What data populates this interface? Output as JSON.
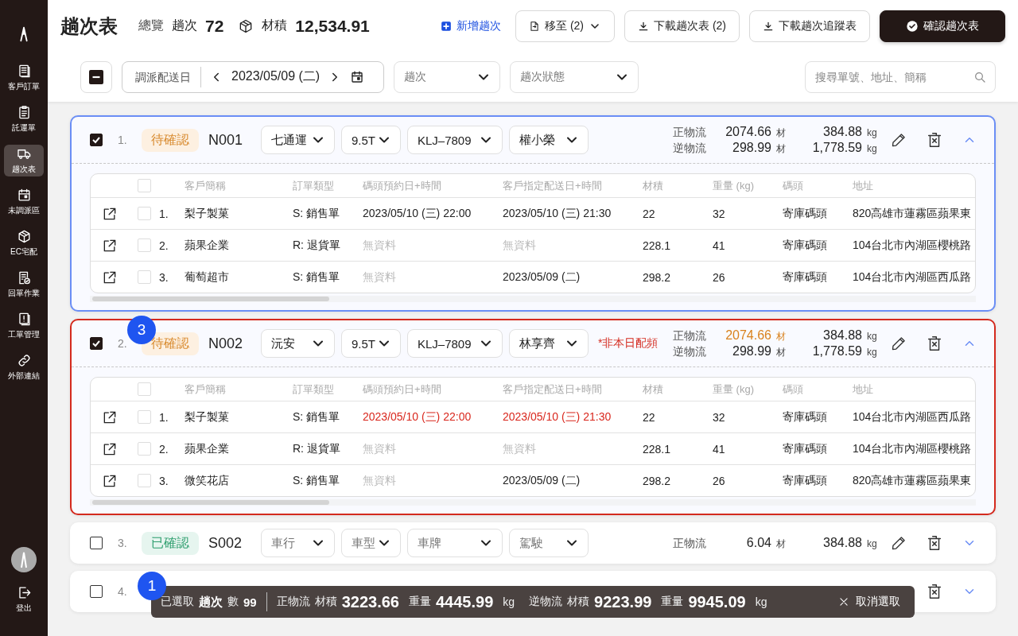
{
  "sidebar": {
    "items": [
      {
        "label": "客戶訂單",
        "kind": "orders",
        "selected": false
      },
      {
        "label": "託運單",
        "kind": "waybill",
        "selected": false
      },
      {
        "label": "趟次表",
        "kind": "trips",
        "selected": true
      },
      {
        "label": "未調派區",
        "kind": "unassigned",
        "selected": false
      },
      {
        "label": "EC宅配",
        "kind": "ec",
        "selected": false
      },
      {
        "label": "回單作業",
        "kind": "receipts",
        "selected": false
      },
      {
        "label": "工單管理",
        "kind": "workorders",
        "selected": false
      },
      {
        "label": "外部連結",
        "kind": "links",
        "selected": false
      }
    ],
    "logout": "登出"
  },
  "header": {
    "title": "趟次表",
    "overview_label": "總覽",
    "trip_label": "趟次",
    "trip_count": "72",
    "volume_label": "材積",
    "volume": "12,534.91",
    "actions": [
      {
        "label": "新增趟次",
        "kind": "link"
      },
      {
        "label": "移至 (2)",
        "kind": "menu"
      },
      {
        "label": "下載趟次表 (2)",
        "kind": "download"
      },
      {
        "label": "下載趟次追蹤表",
        "kind": "download"
      },
      {
        "label": "確認趟次表",
        "kind": "primary"
      }
    ]
  },
  "filters": {
    "date_label": "調派配送日",
    "date": "2023/05/09 (二)",
    "selects": [
      {
        "placeholder": "趟次"
      },
      {
        "placeholder": "趟次狀態"
      }
    ],
    "search": {
      "placeholder": "搜尋單號、地址、簡稱"
    }
  },
  "trips": [
    {
      "checked": true,
      "index": "1.",
      "status": {
        "label": "待確認",
        "kind": "pending"
      },
      "code": "N001",
      "focused": true,
      "error": false,
      "expanded": true,
      "fields": [
        {
          "value": "七通運"
        },
        {
          "value": "9.5T"
        },
        {
          "value": "KLJ–7809"
        },
        {
          "value": "權小榮"
        }
      ],
      "flows": [
        {
          "label": "正物流",
          "volume": "2074.66",
          "volume_unit": "材",
          "weight": "384.88",
          "weight_unit": "kg",
          "highlighted": false
        },
        {
          "label": "逆物流",
          "volume": "298.99",
          "volume_unit": "材",
          "weight": "1,778.59",
          "weight_unit": "kg",
          "highlighted": false
        }
      ],
      "actions": [
        {
          "kind": "edit"
        },
        {
          "kind": "delete"
        },
        {
          "kind": "toggle"
        }
      ],
      "orders": {
        "columns": [
          "客戶簡稱",
          "訂單類型",
          "碼頭預約日+時間",
          "客戶指定配送日+時間",
          "材積",
          "重量 (kg)",
          "碼頭",
          "地址"
        ],
        "all_checked": false,
        "rows": [
          {
            "checked": false,
            "index": "1.",
            "cells": [
              {
                "text": "梨子製菓",
                "kind": "normal"
              },
              {
                "text": "S: 銷售單",
                "kind": "normal"
              },
              {
                "text": "2023/05/10 (三) 22:00",
                "kind": "normal"
              },
              {
                "text": "2023/05/10 (三) 21:30",
                "kind": "normal"
              },
              {
                "text": "22",
                "kind": "normal"
              },
              {
                "text": "32",
                "kind": "normal"
              },
              {
                "text": "寄庫碼頭",
                "kind": "normal"
              },
              {
                "text": "820高雄市蓮霧區蘋果東",
                "kind": "normal"
              }
            ]
          },
          {
            "checked": false,
            "index": "2.",
            "cells": [
              {
                "text": "蘋果企業",
                "kind": "normal"
              },
              {
                "text": "R: 退貨單",
                "kind": "normal"
              },
              {
                "text": "無資料",
                "kind": "muted"
              },
              {
                "text": "無資料",
                "kind": "muted"
              },
              {
                "text": "228.1",
                "kind": "normal"
              },
              {
                "text": "41",
                "kind": "normal"
              },
              {
                "text": "寄庫碼頭",
                "kind": "normal"
              },
              {
                "text": "104台北市內湖區櫻桃路",
                "kind": "normal"
              }
            ]
          },
          {
            "checked": false,
            "index": "3.",
            "cells": [
              {
                "text": "葡萄超市",
                "kind": "normal"
              },
              {
                "text": "S: 銷售單",
                "kind": "normal"
              },
              {
                "text": "無資料",
                "kind": "muted"
              },
              {
                "text": "2023/05/09 (二)",
                "kind": "normal"
              },
              {
                "text": "298.2",
                "kind": "normal"
              },
              {
                "text": "26",
                "kind": "normal"
              },
              {
                "text": "寄庫碼頭",
                "kind": "normal"
              },
              {
                "text": "104台北市內湖區西瓜路",
                "kind": "normal"
              }
            ]
          }
        ]
      }
    },
    {
      "checked": true,
      "index": "2.",
      "status": {
        "label": "待確認",
        "kind": "pending"
      },
      "code": "N002",
      "focused": false,
      "error": true,
      "expanded": true,
      "marker": "3",
      "warning": "*非本日配頻",
      "fields": [
        {
          "value": "沅安"
        },
        {
          "value": "9.5T"
        },
        {
          "value": "KLJ–7809"
        },
        {
          "value": "林享齊"
        }
      ],
      "flows": [
        {
          "label": "正物流",
          "volume": "2074.66",
          "volume_unit": "材",
          "weight": "384.88",
          "weight_unit": "kg",
          "highlighted": true
        },
        {
          "label": "逆物流",
          "volume": "298.99",
          "volume_unit": "材",
          "weight": "1,778.59",
          "weight_unit": "kg",
          "highlighted": false
        }
      ],
      "actions": [
        {
          "kind": "edit"
        },
        {
          "kind": "delete"
        },
        {
          "kind": "toggle"
        }
      ],
      "orders": {
        "columns": [
          "客戶簡稱",
          "訂單類型",
          "碼頭預約日+時間",
          "客戶指定配送日+時間",
          "材積",
          "重量 (kg)",
          "碼頭",
          "地址"
        ],
        "all_checked": false,
        "rows": [
          {
            "checked": false,
            "index": "1.",
            "cells": [
              {
                "text": "梨子製菓",
                "kind": "normal"
              },
              {
                "text": "S: 銷售單",
                "kind": "normal"
              },
              {
                "text": "2023/05/10 (三) 22:00",
                "kind": "alert"
              },
              {
                "text": "2023/05/10 (三) 21:30",
                "kind": "alert"
              },
              {
                "text": "22",
                "kind": "normal"
              },
              {
                "text": "32",
                "kind": "normal"
              },
              {
                "text": "寄庫碼頭",
                "kind": "normal"
              },
              {
                "text": "104台北市內湖區西瓜路",
                "kind": "normal"
              }
            ]
          },
          {
            "checked": false,
            "index": "2.",
            "cells": [
              {
                "text": "蘋果企業",
                "kind": "normal"
              },
              {
                "text": "R: 退貨單",
                "kind": "normal"
              },
              {
                "text": "無資料",
                "kind": "muted"
              },
              {
                "text": "無資料",
                "kind": "muted"
              },
              {
                "text": "228.1",
                "kind": "normal"
              },
              {
                "text": "41",
                "kind": "normal"
              },
              {
                "text": "寄庫碼頭",
                "kind": "normal"
              },
              {
                "text": "104台北市內湖區櫻桃路",
                "kind": "normal"
              }
            ]
          },
          {
            "checked": false,
            "index": "3.",
            "cells": [
              {
                "text": "微笑花店",
                "kind": "normal"
              },
              {
                "text": "S: 銷售單",
                "kind": "normal"
              },
              {
                "text": "無資料",
                "kind": "muted"
              },
              {
                "text": "2023/05/09 (二)",
                "kind": "normal"
              },
              {
                "text": "298.2",
                "kind": "normal"
              },
              {
                "text": "26",
                "kind": "normal"
              },
              {
                "text": "寄庫碼頭",
                "kind": "normal"
              },
              {
                "text": "820高雄市蓮霧區蘋果東",
                "kind": "normal"
              }
            ]
          }
        ]
      }
    },
    {
      "checked": false,
      "index": "3.",
      "status": {
        "label": "已確認",
        "kind": "confirmed"
      },
      "code": "S002",
      "focused": false,
      "error": false,
      "expanded": false,
      "fields": [
        {
          "placeholder": "車行"
        },
        {
          "placeholder": "車型"
        },
        {
          "placeholder": "車牌"
        },
        {
          "placeholder": "駕駛"
        }
      ],
      "flows": [
        {
          "label": "正物流",
          "volume": "6.04",
          "volume_unit": "材",
          "weight": "384.88",
          "weight_unit": "kg",
          "highlighted": false
        }
      ],
      "actions": [
        {
          "kind": "edit"
        },
        {
          "kind": "delete"
        },
        {
          "kind": "toggle"
        }
      ]
    },
    {
      "checked": false,
      "index": "4.",
      "focused": false,
      "error": false,
      "expanded": false,
      "actions": [
        {
          "kind": "delete"
        },
        {
          "kind": "toggle"
        }
      ]
    }
  ],
  "selection_bar": {
    "marker": "1",
    "selected_label": "已選取",
    "trip_label": "趟次",
    "count_label": "數",
    "count": "99",
    "groups": [
      {
        "label": "正物流",
        "volume_label": "材積",
        "volume": "3223.66",
        "weight_label": "重量",
        "weight": "4445.99",
        "unit": "kg"
      },
      {
        "label": "逆物流",
        "volume_label": "材積",
        "volume": "9223.99",
        "weight_label": "重量",
        "weight": "9945.09",
        "unit": "kg"
      }
    ],
    "cancel": "取消選取"
  }
}
